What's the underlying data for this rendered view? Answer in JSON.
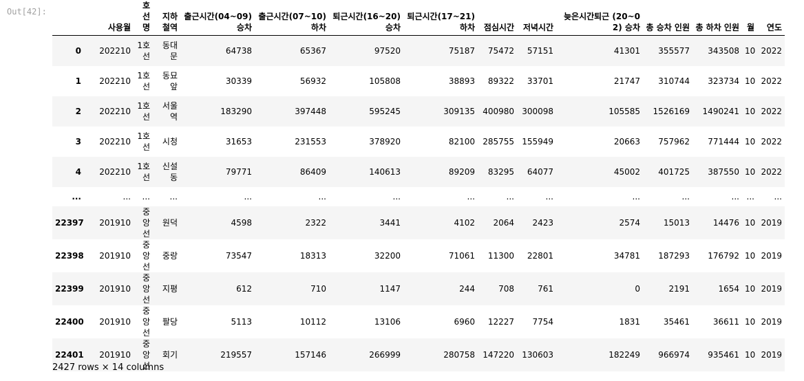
{
  "prompt_label": "Out[42]:",
  "columns": [
    "",
    "사용월",
    "호선명",
    "지하철역",
    "출근시간(04~09) 승차",
    "출근시간(07~10) 하차",
    "퇴근시간(16~20) 승차",
    "퇴근시간(17~21) 하차",
    "점심시간",
    "저녁시간",
    "늦은시간퇴근 (20~02) 승차",
    "총 승차 인원",
    "총 하차 인원",
    "월",
    "연도"
  ],
  "rows": [
    [
      "0",
      "202210",
      "1호선",
      "동대문",
      "64738",
      "65367",
      "97520",
      "75187",
      "75472",
      "57151",
      "41301",
      "355577",
      "343508",
      "10",
      "2022"
    ],
    [
      "1",
      "202210",
      "1호선",
      "동묘앞",
      "30339",
      "56932",
      "105808",
      "38893",
      "89322",
      "33701",
      "21747",
      "310744",
      "323734",
      "10",
      "2022"
    ],
    [
      "2",
      "202210",
      "1호선",
      "서울역",
      "183290",
      "397448",
      "595245",
      "309135",
      "400980",
      "300098",
      "105585",
      "1526169",
      "1490241",
      "10",
      "2022"
    ],
    [
      "3",
      "202210",
      "1호선",
      "시청",
      "31653",
      "231553",
      "378920",
      "82100",
      "285755",
      "155949",
      "20663",
      "757962",
      "771444",
      "10",
      "2022"
    ],
    [
      "4",
      "202210",
      "1호선",
      "신설동",
      "79771",
      "86409",
      "140613",
      "89209",
      "83295",
      "64077",
      "45002",
      "401725",
      "387550",
      "10",
      "2022"
    ],
    [
      "...",
      "...",
      "...",
      "...",
      "...",
      "...",
      "...",
      "...",
      "...",
      "...",
      "...",
      "...",
      "...",
      "...",
      "..."
    ],
    [
      "22397",
      "201910",
      "중앙선",
      "원덕",
      "4598",
      "2322",
      "3441",
      "4102",
      "2064",
      "2423",
      "2574",
      "15013",
      "14476",
      "10",
      "2019"
    ],
    [
      "22398",
      "201910",
      "중앙선",
      "중랑",
      "73547",
      "18313",
      "32200",
      "71061",
      "11300",
      "22801",
      "34781",
      "187293",
      "176792",
      "10",
      "2019"
    ],
    [
      "22399",
      "201910",
      "중앙선",
      "지평",
      "612",
      "710",
      "1147",
      "244",
      "708",
      "761",
      "0",
      "2191",
      "1654",
      "10",
      "2019"
    ],
    [
      "22400",
      "201910",
      "중앙선",
      "팔당",
      "5113",
      "10112",
      "13106",
      "6960",
      "12227",
      "7754",
      "1831",
      "35461",
      "36611",
      "10",
      "2019"
    ],
    [
      "22401",
      "201910",
      "중앙선",
      "회기",
      "219557",
      "157146",
      "266999",
      "280758",
      "147220",
      "130603",
      "182249",
      "966974",
      "935461",
      "10",
      "2019"
    ]
  ],
  "footer": "2427 rows × 14 columns"
}
